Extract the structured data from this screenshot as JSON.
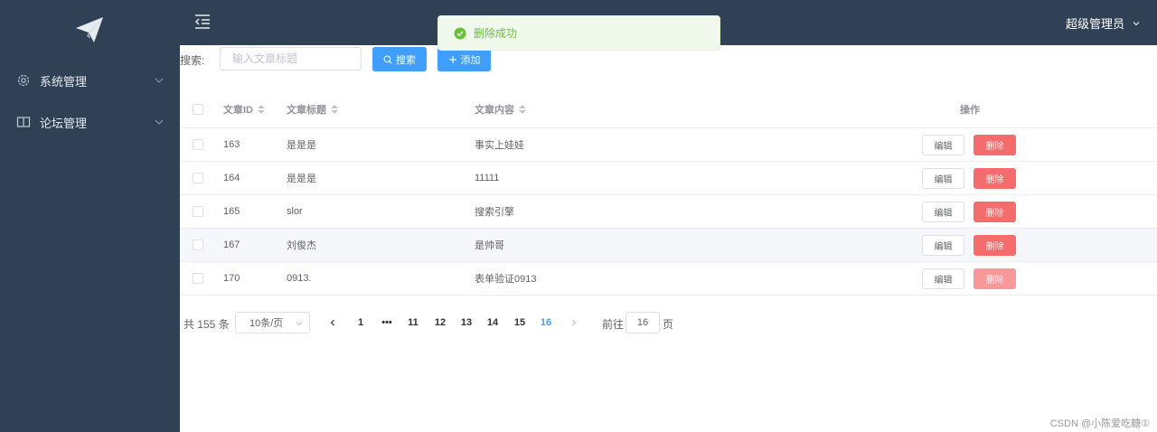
{
  "sidebar": {
    "logo_icon": "paper-plane-icon",
    "items": [
      {
        "label": "系统管理",
        "icon": "gear-icon"
      },
      {
        "label": "论坛管理",
        "icon": "book-icon"
      }
    ]
  },
  "topbar": {
    "user_label": "超级管理员"
  },
  "toast": {
    "message": "删除成功",
    "type": "success"
  },
  "search": {
    "label": "搜索:",
    "placeholder": "输入文章标题",
    "search_button": "搜索",
    "add_button": "添加"
  },
  "table": {
    "columns": {
      "id": "文章ID",
      "title": "文章标题",
      "content": "文章内容",
      "ops": "操作"
    },
    "edit_label": "编辑",
    "delete_label": "删除",
    "rows": [
      {
        "id": "163",
        "title": "是是是",
        "content": "事实上娃娃"
      },
      {
        "id": "164",
        "title": "是是是",
        "content": "11111"
      },
      {
        "id": "165",
        "title": "slor",
        "content": "搜索引擎"
      },
      {
        "id": "167",
        "title": "刘俊杰",
        "content": "是帅哥"
      },
      {
        "id": "170",
        "title": "0913.",
        "content": "表单验证0913"
      }
    ]
  },
  "pagination": {
    "total": "共 155 条",
    "page_size": "10条/页",
    "pages": [
      "1",
      "•••",
      "11",
      "12",
      "13",
      "14",
      "15",
      "16"
    ],
    "current": "16",
    "goto_label": "前往",
    "goto_value": "16",
    "page_unit": "页"
  },
  "watermark": "CSDN @小陈爱吃糖①",
  "colors": {
    "sidebar_bg": "#304156",
    "primary": "#409eff",
    "danger": "#f56c6c",
    "success": "#67c23a"
  }
}
